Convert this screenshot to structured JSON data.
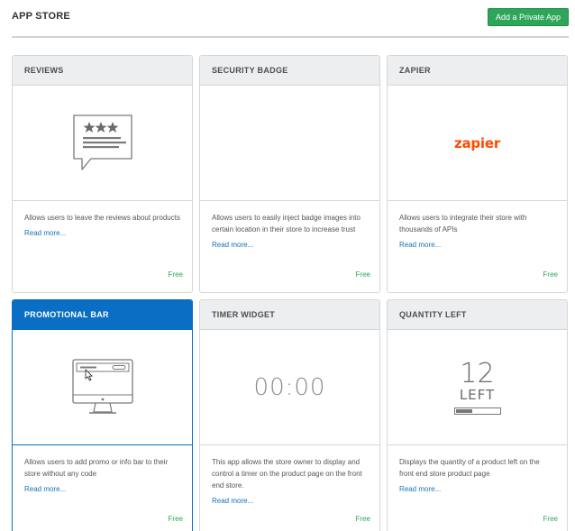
{
  "header": {
    "title": "APP STORE",
    "add_button": "Add a Private App"
  },
  "cards": [
    {
      "name": "REVIEWS",
      "description": "Allows users to leave the reviews about products",
      "read_more": "Read more...",
      "price": "Free",
      "icon": "review-speech-bubble-icon",
      "active": false
    },
    {
      "name": "SECURITY BADGE",
      "description": "Allows users to easily inject badge images into certain location in their store to increase trust",
      "read_more": "Read more...",
      "price": "Free",
      "icon": "",
      "active": false
    },
    {
      "name": "ZAPIER",
      "description": "Allows users to integrate their store with thousands of APIs",
      "read_more": "Read more...",
      "price": "Free",
      "icon": "zapier-logo",
      "logo_text": "zapier",
      "active": false
    },
    {
      "name": "PROMOTIONAL BAR",
      "description": "Allows users to add promo or info bar to their store without any code",
      "read_more": "Read more...",
      "price": "Free",
      "icon": "monitor-promo-bar-icon",
      "active": true
    },
    {
      "name": "TIMER WIDGET",
      "description": "This app allows the store owner to display and control a timer on the product page on the front end store.",
      "read_more": "Read more...",
      "price": "Free",
      "icon": "timer-icon",
      "timer_text": "00:00",
      "active": false
    },
    {
      "name": "QUANTITY LEFT",
      "description": "Displays the quantity of a product left on the front end store product page",
      "read_more": "Read more...",
      "price": "Free",
      "icon": "quantity-left-icon",
      "qty_number": "12",
      "qty_label": "LEFT",
      "qty_fill": 0.4,
      "active": false
    }
  ],
  "colors": {
    "accent": "#0a6ec4",
    "button_green": "#2ea65a",
    "price_green": "#2ea65a",
    "link": "#1673b8",
    "zapier_orange": "#ff4a00"
  }
}
